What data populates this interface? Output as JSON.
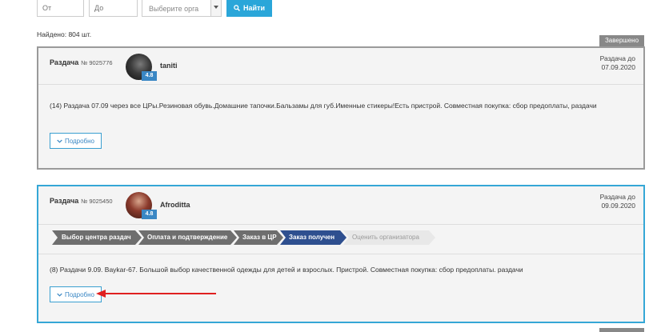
{
  "filters": {
    "from_placeholder": "От",
    "to_placeholder": "До",
    "org_select": "Выберите орга",
    "search_label": "Найти"
  },
  "found_text": "Найдено: 804 шт.",
  "cards": [
    {
      "status": "Завершено",
      "title": "Раздача",
      "number": "№ 9025776",
      "username": "taniti",
      "rating": "4.8",
      "date_label": "Раздача до",
      "date": "07.09.2020",
      "description": "(14) Раздача 07.09 через все ЦРы.Резиновая обувь.Домашние тапочки.Бальзамы для губ.Именные стикеры!Есть пристрой. Совместная покупка: сбор предоплаты, раздачи",
      "more_label": "Подробно"
    },
    {
      "title": "Раздача",
      "number": "№ 9025450",
      "username": "Afroditta",
      "rating": "4.8",
      "date_label": "Раздача до",
      "date": "09.09.2020",
      "steps": [
        "Выбор центра раздач",
        "Оплата и подтверждение",
        "Заказ в ЦР",
        "Заказ получен",
        "Оценить организатора"
      ],
      "description": "(8) Раздачи 9.09. Baykar-67. Большой выбор качественной одежды для детей и взрослых. Пристрой. Совместная покупка: сбор предоплаты. раздачи",
      "more_label": "Подробно"
    }
  ],
  "colors": {
    "accent": "#2aa6d9",
    "active_step": "#2e4f8f",
    "done_step": "#6e6e6e",
    "annotation": "#e02020"
  }
}
